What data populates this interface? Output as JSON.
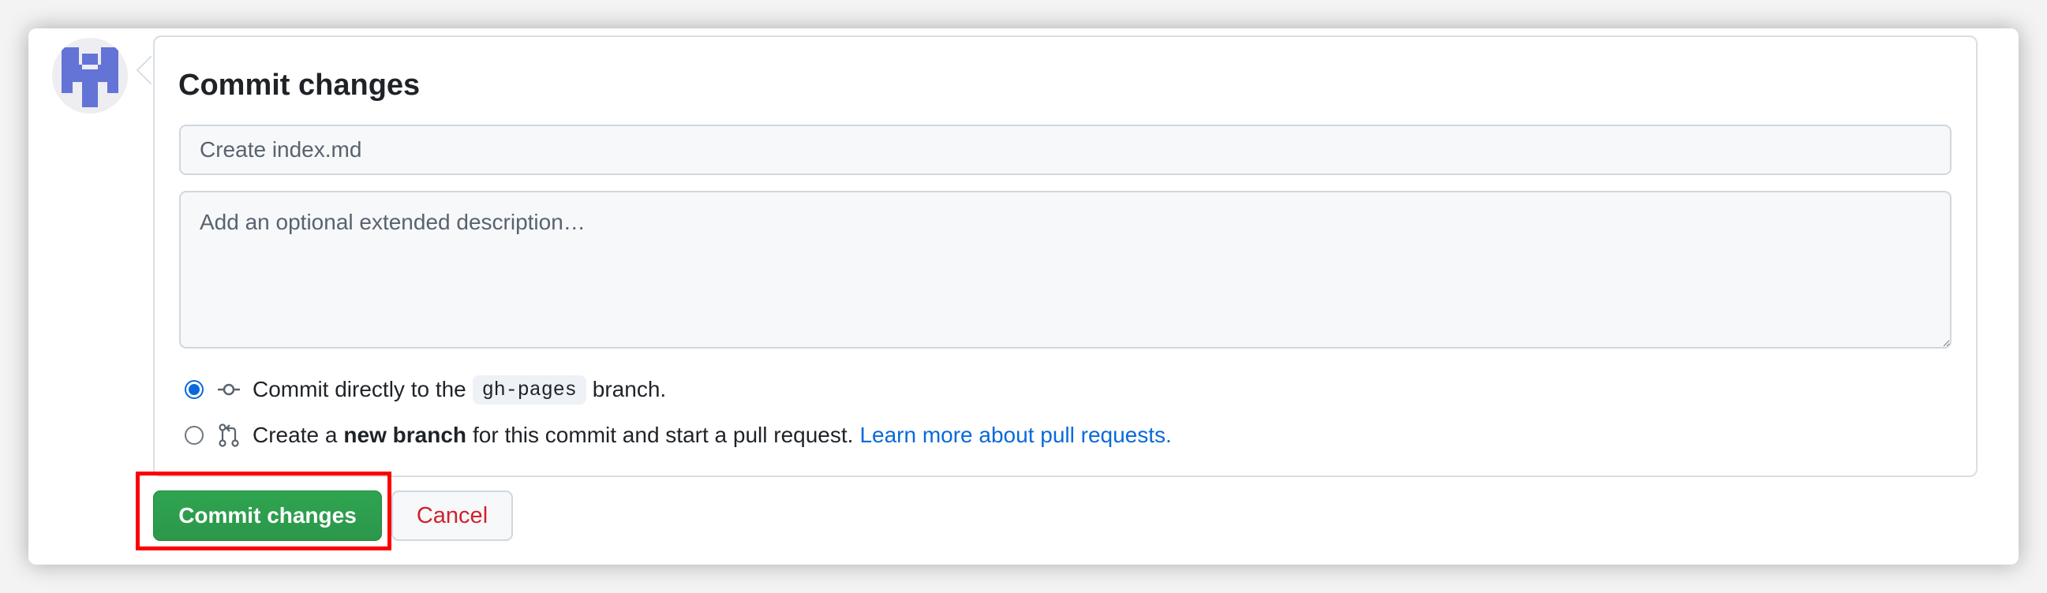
{
  "form": {
    "title": "Commit changes",
    "summary_placeholder": "Create index.md",
    "description_placeholder": "Add an optional extended description…"
  },
  "options": {
    "direct": {
      "selected": true,
      "prefix": "Commit directly to the",
      "branch": "gh-pages",
      "suffix": "branch."
    },
    "new_branch": {
      "selected": false,
      "prefix": "Create a",
      "emphasis": "new branch",
      "suffix": "for this commit and start a pull request.",
      "link": "Learn more about pull requests."
    }
  },
  "buttons": {
    "commit": "Commit changes",
    "cancel": "Cancel"
  },
  "icons": {
    "avatar": "identicon-avatar",
    "direct": "git-commit-icon",
    "new_branch": "git-pull-request-icon"
  },
  "colors": {
    "commit_green": "#2da44e",
    "cancel_red": "#cf222e",
    "link_blue": "#0969da",
    "highlight_red": "#ff0000"
  }
}
